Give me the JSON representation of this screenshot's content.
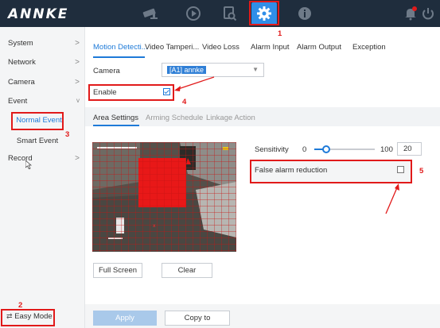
{
  "app": {
    "brand": "ANNKE"
  },
  "topnav": {
    "icons": [
      "camera-icon",
      "playback-icon",
      "search-icon",
      "gear-icon",
      "info-icon",
      "bell-icon",
      "power-icon"
    ],
    "active_color": "#2f8ee8"
  },
  "sidebar": {
    "items": [
      {
        "label": "System",
        "chevron": ">"
      },
      {
        "label": "Network",
        "chevron": ">"
      },
      {
        "label": "Camera",
        "chevron": ">"
      },
      {
        "label": "Event",
        "chevron": "v"
      },
      {
        "label": "Record",
        "chevron": ">"
      }
    ],
    "sub_items": [
      "Normal Event",
      "Smart Event"
    ],
    "easy_mode_label": "Easy Mode"
  },
  "main": {
    "tabs": [
      "Motion Detecti...",
      "Video Tamperi...",
      "Video Loss",
      "Alarm Input",
      "Alarm Output",
      "Exception"
    ],
    "camera_label": "Camera",
    "camera_value": "[A1] annke",
    "enable_label": "Enable",
    "enable_checked": true,
    "subtabs": [
      "Area Settings",
      "Arming Schedule",
      "Linkage Action"
    ],
    "sensitivity_label": "Sensitivity",
    "sensitivity_min": "0",
    "sensitivity_max": "100",
    "sensitivity_value": "20",
    "false_alarm_label": "False alarm reduction",
    "false_alarm_checked": false,
    "full_screen_label": "Full Screen",
    "clear_label": "Clear",
    "apply_label": "Apply",
    "copy_to_label": "Copy to"
  },
  "annotations": [
    "1",
    "2",
    "3",
    "4",
    "5"
  ],
  "colors": {
    "accent": "#1e7ad8",
    "topbar": "#1f2d3d",
    "annotation": "#e11a1a"
  }
}
